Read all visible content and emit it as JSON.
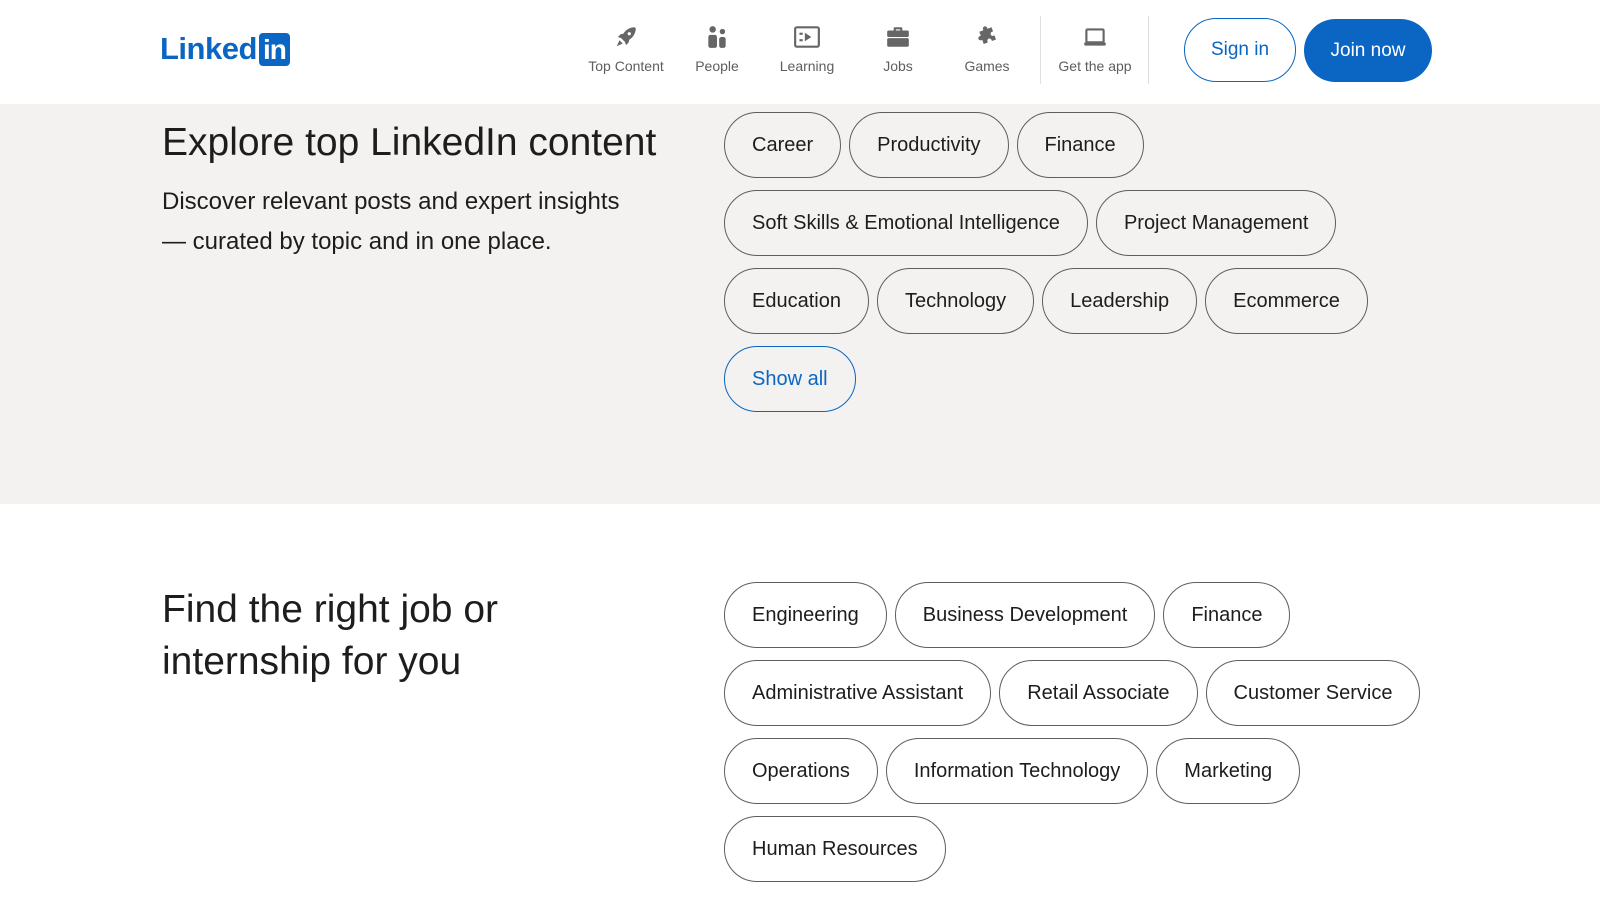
{
  "brand": {
    "word": "Linked",
    "box": "in",
    "color": "#0a66c2"
  },
  "nav": {
    "items": [
      {
        "label": "Top Content",
        "icon": "rocket-icon"
      },
      {
        "label": "People",
        "icon": "people-icon"
      },
      {
        "label": "Learning",
        "icon": "learning-icon"
      },
      {
        "label": "Jobs",
        "icon": "briefcase-icon"
      },
      {
        "label": "Games",
        "icon": "puzzle-icon"
      },
      {
        "label": "Get the app",
        "icon": "laptop-icon"
      }
    ]
  },
  "auth": {
    "sign_in": "Sign in",
    "join_now": "Join now"
  },
  "explore": {
    "title": "Explore top LinkedIn content",
    "description": "Discover relevant posts and expert insights — curated by topic and in one place.",
    "topics": [
      [
        "Career",
        "Productivity",
        "Finance"
      ],
      [
        "Soft Skills & Emotional Intelligence",
        "Project Management"
      ],
      [
        "Education",
        "Technology",
        "Leadership",
        "Ecommerce"
      ]
    ],
    "show_all": "Show all"
  },
  "jobs": {
    "title": "Find the right job or internship for you",
    "categories": [
      [
        "Engineering",
        "Business Development",
        "Finance"
      ],
      [
        "Administrative Assistant",
        "Retail Associate",
        "Customer Service"
      ],
      [
        "Operations",
        "Information Technology",
        "Marketing"
      ],
      [
        "Human Resources"
      ]
    ]
  },
  "colors": {
    "accent": "#0a66c2",
    "section_bg": "#f3f2f0",
    "text": "#1d1d1d",
    "muted": "#5e5e5e"
  }
}
